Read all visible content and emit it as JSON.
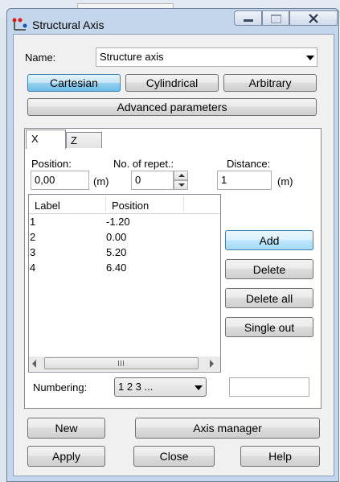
{
  "window": {
    "title": "Structural Axis"
  },
  "name_field": {
    "label": "Name:",
    "value": "Structure axis"
  },
  "type_buttons": [
    {
      "label": "Cartesian",
      "selected": true
    },
    {
      "label": "Cylindrical",
      "selected": false
    },
    {
      "label": "Arbitrary",
      "selected": false
    }
  ],
  "advanced_button": "Advanced parameters",
  "tabs": [
    {
      "label": "X",
      "active": true
    },
    {
      "label": "Z",
      "active": false
    }
  ],
  "position": {
    "label": "Position:",
    "value": "0,00",
    "unit": "(m)"
  },
  "repetitions": {
    "label": "No. of repet.:",
    "value": "0"
  },
  "distance": {
    "label": "Distance:",
    "value": "1",
    "unit": "(m)"
  },
  "axis_list": {
    "columns": [
      "Label",
      "Position"
    ],
    "rows": [
      {
        "label": "1",
        "position": "-1.20"
      },
      {
        "label": "2",
        "position": "0.00"
      },
      {
        "label": "3",
        "position": "5.20"
      },
      {
        "label": "4",
        "position": "6.40"
      }
    ]
  },
  "list_actions": {
    "add": "Add",
    "delete": "Delete",
    "delete_all": "Delete all",
    "single_out": "Single out"
  },
  "numbering": {
    "label": "Numbering:",
    "value": "1 2 3 ...",
    "extra_value": ""
  },
  "bottom_buttons": {
    "new": "New",
    "axis_manager": "Axis manager",
    "apply": "Apply",
    "close": "Close",
    "help": "Help"
  },
  "colors": {
    "frame": "#c3d6ec",
    "selected_button": "#6cbde6",
    "focus_button": "#a7d9f5"
  }
}
